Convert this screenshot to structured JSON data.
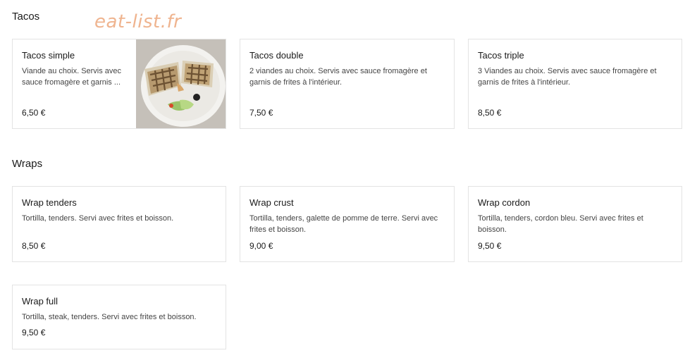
{
  "watermark": "eat-list.fr",
  "sections": [
    {
      "title": "Tacos",
      "items": [
        {
          "name": "Tacos simple",
          "desc": "Viande au choix. Servis avec sauce fromagère et garnis ...",
          "price": "6,50 €"
        },
        {
          "name": "Tacos double",
          "desc": "2 viandes au choix. Servis avec sauce fromagère et garnis de frites à l'intérieur.",
          "price": "7,50 €"
        },
        {
          "name": "Tacos triple",
          "desc": "3 Viandes au choix. Servis avec sauce fromagère et garnis de frites à l'intérieur.",
          "price": "8,50 €"
        }
      ]
    },
    {
      "title": "Wraps",
      "items": [
        {
          "name": "Wrap tenders",
          "desc": "Tortilla, tenders. Servi avec frites et boisson.",
          "price": "8,50 €"
        },
        {
          "name": "Wrap crust",
          "desc": "Tortilla, tenders, galette de pomme de terre. Servi avec frites et boisson.",
          "price": "9,00 €"
        },
        {
          "name": "Wrap cordon",
          "desc": "Tortilla, tenders, cordon bleu. Servi avec frites et boisson.",
          "price": "9,50 €"
        },
        {
          "name": "Wrap full",
          "desc": "Tortilla, steak, tenders. Servi avec frites et boisson.",
          "price": "9,50 €"
        }
      ]
    }
  ]
}
